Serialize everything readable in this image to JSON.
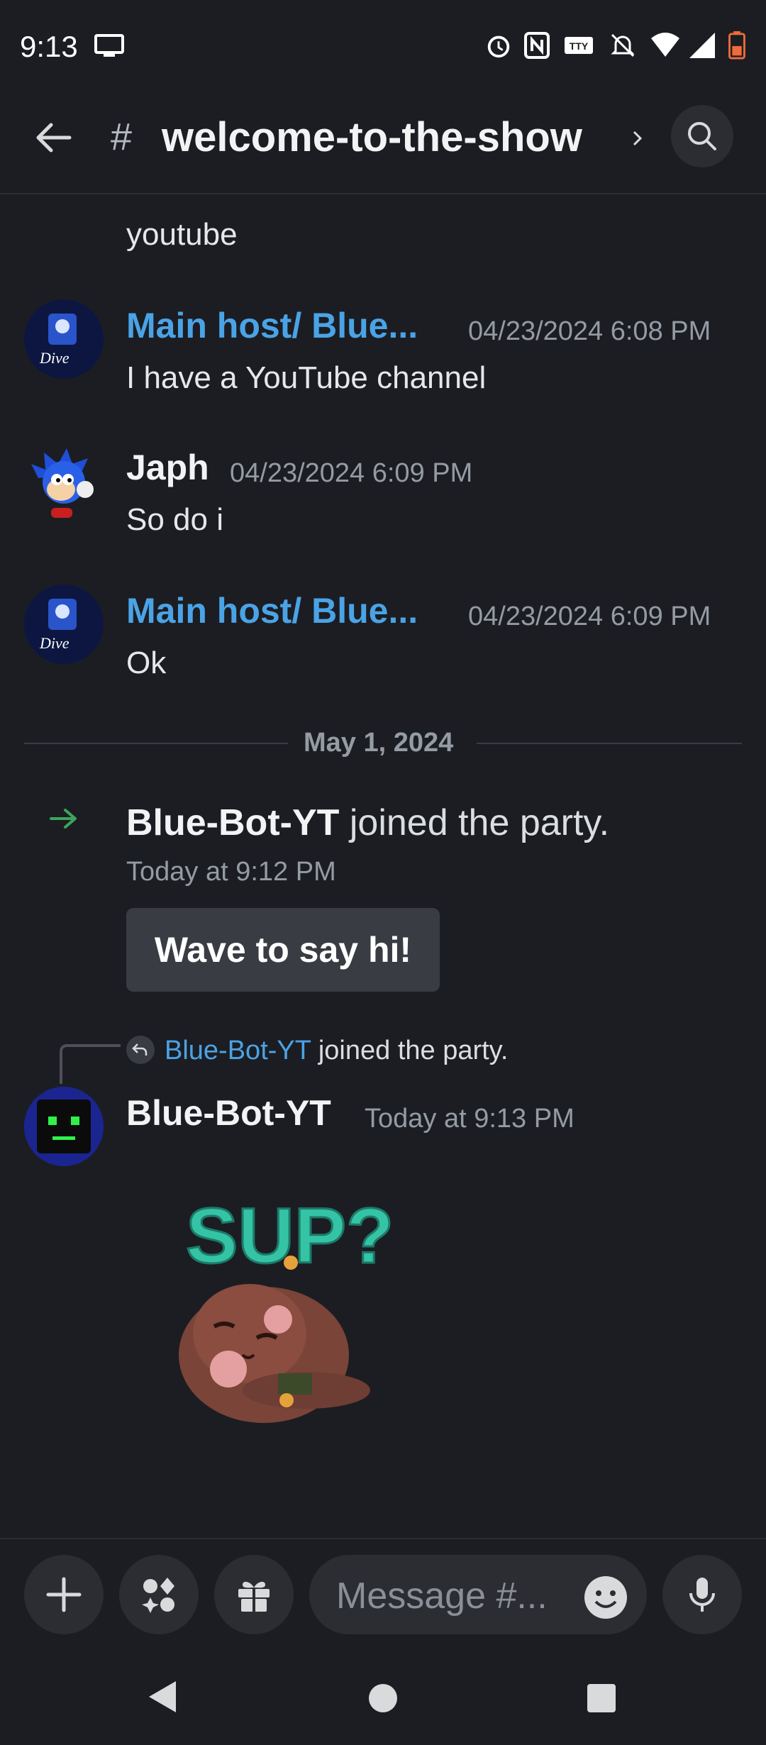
{
  "status_bar": {
    "time": "9:13"
  },
  "header": {
    "hash": "#",
    "channel": "welcome-to-the-show"
  },
  "messages": {
    "partial_top": "youtube",
    "m1": {
      "author": "Main host/ Blue...",
      "timestamp": "04/23/2024 6:08 PM",
      "text": "I have a YouTube channel"
    },
    "m2": {
      "author": "Japh",
      "timestamp": "04/23/2024 6:09 PM",
      "text": "So do i"
    },
    "m3": {
      "author": "Main host/ Blue...",
      "timestamp": "04/23/2024 6:09 PM",
      "text": "Ok"
    }
  },
  "date_divider": "May 1, 2024",
  "join": {
    "user": "Blue-Bot-YT",
    "action": "joined the party.",
    "time": "Today at 9:12 PM",
    "wave_button": "Wave to say hi!"
  },
  "reply": {
    "ref_user": "Blue-Bot-YT",
    "ref_text": "joined the party.",
    "author": "Blue-Bot-YT",
    "timestamp": "Today at 9:13 PM",
    "sticker_text": "SUP?"
  },
  "composer": {
    "placeholder": "Message #..."
  },
  "colors": {
    "accent_blue": "#4aa3e6",
    "join_green": "#3ba55c",
    "background": "#1c1d22"
  }
}
